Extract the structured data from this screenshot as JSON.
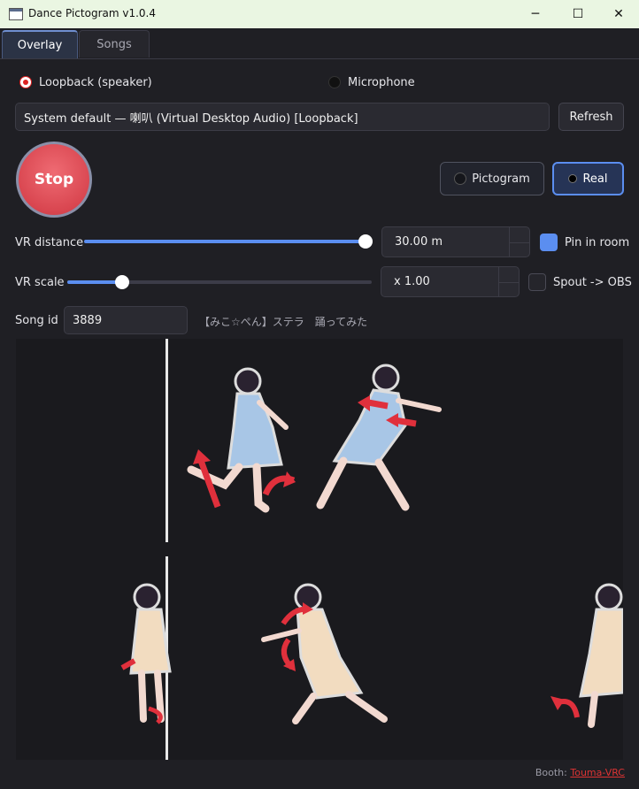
{
  "window": {
    "title": "Dance Pictogram v1.0.4",
    "minimize": "─",
    "maximize": "☐",
    "close": "✕"
  },
  "tabs": [
    {
      "label": "Overlay"
    },
    {
      "label": "Songs"
    }
  ],
  "source": {
    "loopback_label": "Loopback (speaker)",
    "microphone_label": "Microphone",
    "selected": "loopback"
  },
  "device": {
    "value": "System default — 喇叭 (Virtual Desktop Audio) [Loopback]",
    "refresh_label": "Refresh"
  },
  "stop_label": "Stop",
  "mode": {
    "pictogram_label": "Pictogram",
    "real_label": "Real",
    "selected": "real"
  },
  "vr_distance": {
    "label": "VR distance",
    "value": "30.00 m",
    "slider_fraction": 0.98
  },
  "pin_in_room": {
    "label": "Pin in room",
    "checked": true
  },
  "vr_scale": {
    "label": "VR scale",
    "value": "x 1.00",
    "slider_fraction": 0.18
  },
  "spout": {
    "label": "Spout -> OBS",
    "checked": false
  },
  "song": {
    "label": "Song id",
    "value": "3889",
    "title": "【みこ☆ぺん】ステラ　踊ってみた"
  },
  "colors": {
    "accent": "#5b8ef0",
    "stop": "#d94650",
    "arrow": "#e0303c",
    "link": "#d33"
  },
  "footer": {
    "prefix": "Booth:",
    "link": "Touma-VRC"
  }
}
